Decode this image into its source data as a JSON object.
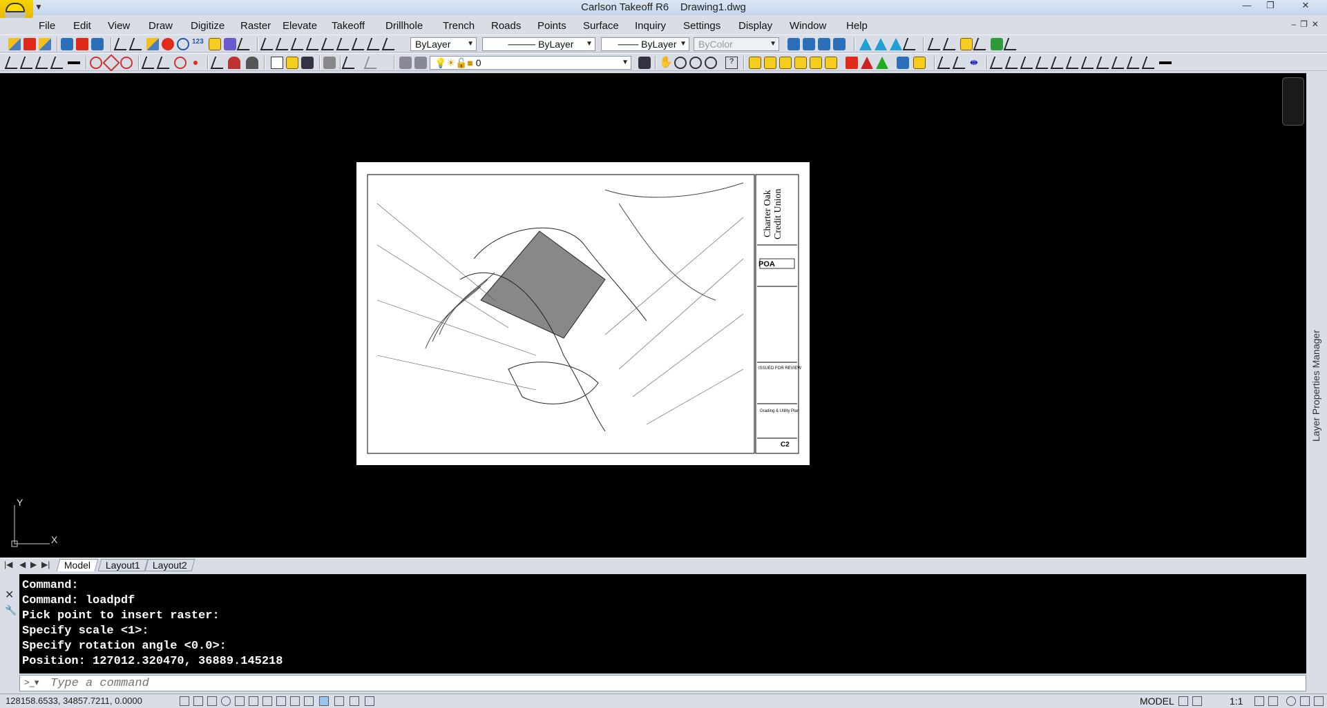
{
  "window": {
    "app_title": "Carlson Takeoff R6",
    "document": "Drawing1.dwg",
    "controls": {
      "minimize": "—",
      "restore": "❐",
      "close": "✕"
    }
  },
  "menu": [
    "File",
    "Edit",
    "View",
    "Draw",
    "Digitize",
    "Raster",
    "Elevate",
    "Takeoff",
    "Drillhole",
    "Trench",
    "Roads",
    "Points",
    "Surface",
    "Inquiry",
    "Settings",
    "Display",
    "Window",
    "Help"
  ],
  "toolbar": {
    "layer_color": "ByLayer",
    "linetype": "ByLayer",
    "lineweight": "ByLayer",
    "plotstyle": "ByColor",
    "layer_name": "0"
  },
  "canvas": {
    "ucs_y": "Y",
    "ucs_x": "X",
    "sheet": {
      "title_line1": "Charter Oak",
      "title_line2": "Credit Union",
      "logo": "POA",
      "issued": "ISSUED FOR REVIEW",
      "plan_title": "Grading & Utility Plan",
      "sheet_number": "C2"
    }
  },
  "side_panel": {
    "label": "Layer Properties Manager"
  },
  "tabs": {
    "items": [
      "Model",
      "Layout1",
      "Layout2"
    ],
    "active": "Model"
  },
  "command": {
    "history": [
      "Command:",
      "Command: loadpdf",
      "Pick point to insert raster:",
      "Specify scale <1>:",
      "Specify rotation angle <0.0>:",
      "Position: 127012.320470, 36889.145218"
    ],
    "placeholder": "Type a command"
  },
  "status": {
    "coordinates": "128158.6533, 34857.7211, 0.0000",
    "space": "MODEL",
    "scale": "1:1"
  }
}
